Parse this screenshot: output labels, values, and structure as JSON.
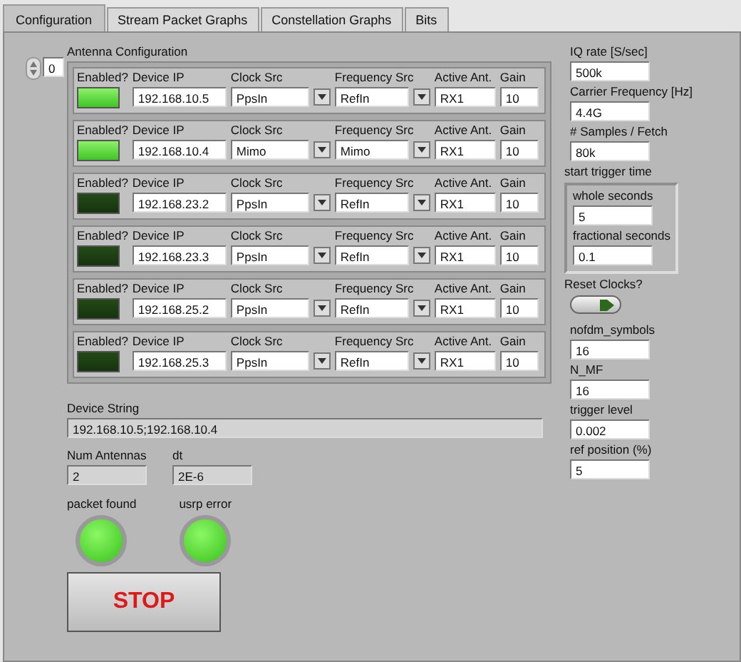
{
  "tabs": [
    {
      "label": "Configuration",
      "selected": true
    },
    {
      "label": "Stream Packet Graphs",
      "selected": false
    },
    {
      "label": "Constellation Graphs",
      "selected": false
    },
    {
      "label": "Bits",
      "selected": false
    }
  ],
  "array_index": "0",
  "antenna_configuration": {
    "label": "Antenna Configuration",
    "rows": [
      {
        "enabled_label": "Enabled?",
        "enabled": true,
        "ip_label": "Device IP",
        "ip": "192.168.10.5",
        "clock_label": "Clock Src",
        "clock": "PpsIn",
        "freq_label": "Frequency Src",
        "freq": "RefIn",
        "ant_label": "Active Ant.",
        "ant": "RX1",
        "gain_label": "Gain",
        "gain": "10"
      },
      {
        "enabled_label": "Enabled?",
        "enabled": true,
        "ip_label": "Device IP",
        "ip": "192.168.10.4",
        "clock_label": "Clock Src",
        "clock": "Mimo",
        "freq_label": "Frequency Src",
        "freq": "Mimo",
        "ant_label": "Active Ant.",
        "ant": "RX1",
        "gain_label": "Gain",
        "gain": "10"
      },
      {
        "enabled_label": "Enabled?",
        "enabled": false,
        "ip_label": "Device IP",
        "ip": "192.168.23.2",
        "clock_label": "Clock Src",
        "clock": "PpsIn",
        "freq_label": "Frequency Src",
        "freq": "RefIn",
        "ant_label": "Active Ant.",
        "ant": "RX1",
        "gain_label": "Gain",
        "gain": "10"
      },
      {
        "enabled_label": "Enabled?",
        "enabled": false,
        "ip_label": "Device IP",
        "ip": "192.168.23.3",
        "clock_label": "Clock Src",
        "clock": "PpsIn",
        "freq_label": "Frequency Src",
        "freq": "RefIn",
        "ant_label": "Active Ant.",
        "ant": "RX1",
        "gain_label": "Gain",
        "gain": "10"
      },
      {
        "enabled_label": "Enabled?",
        "enabled": false,
        "ip_label": "Device IP",
        "ip": "192.168.25.2",
        "clock_label": "Clock Src",
        "clock": "PpsIn",
        "freq_label": "Frequency Src",
        "freq": "RefIn",
        "ant_label": "Active Ant.",
        "ant": "RX1",
        "gain_label": "Gain",
        "gain": "10"
      },
      {
        "enabled_label": "Enabled?",
        "enabled": false,
        "ip_label": "Device IP",
        "ip": "192.168.25.3",
        "clock_label": "Clock Src",
        "clock": "PpsIn",
        "freq_label": "Frequency Src",
        "freq": "RefIn",
        "ant_label": "Active Ant.",
        "ant": "RX1",
        "gain_label": "Gain",
        "gain": "10"
      }
    ]
  },
  "device_string": {
    "label": "Device String",
    "value": "192.168.10.5;192.168.10.4"
  },
  "num_antennas": {
    "label": "Num Antennas",
    "value": "2"
  },
  "dt": {
    "label": "dt",
    "value": "2E-6"
  },
  "indicators": [
    {
      "label": "packet found",
      "on": true
    },
    {
      "label": "usrp error",
      "on": true
    }
  ],
  "stop_button": "STOP",
  "right_fields_top": [
    {
      "label": "IQ rate [S/sec]",
      "value": "500k"
    },
    {
      "label": "Carrier Frequency [Hz]",
      "value": "4.4G"
    },
    {
      "label": "# Samples / Fetch",
      "value": "80k"
    }
  ],
  "start_trigger_time": {
    "label": "start trigger time",
    "fields": [
      {
        "label": "whole seconds",
        "value": "5"
      },
      {
        "label": "fractional seconds",
        "value": "0.1"
      }
    ]
  },
  "reset_clocks": {
    "label": "Reset Clocks?",
    "on": true
  },
  "right_fields_bottom": [
    {
      "label": "nofdm_symbols",
      "value": "16"
    },
    {
      "label": "N_MF",
      "value": "16"
    },
    {
      "label": "trigger level",
      "value": "0.002"
    },
    {
      "label": "ref position (%)",
      "value": "5"
    }
  ]
}
